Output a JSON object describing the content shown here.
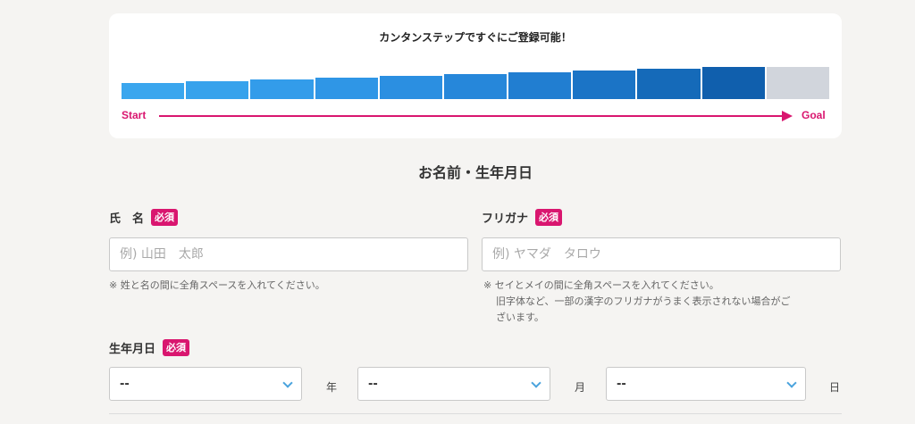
{
  "progress": {
    "title": "カンタンステップですぐにご登録可能！",
    "start_label": "Start",
    "goal_label": "Goal",
    "total_steps": 11,
    "completed_steps": 10,
    "step_colors": [
      "#3aa6ee",
      "#37a2ec",
      "#339cea",
      "#2f96e6",
      "#2b8fe1",
      "#2687da",
      "#217ed1",
      "#1b74c6",
      "#156ab9",
      "#105fad",
      "#d1d5dc"
    ],
    "accent_color": "#d9166f"
  },
  "section": {
    "title": "お名前・生年月日"
  },
  "name_field": {
    "label": "氏　名",
    "required_badge": "必須",
    "placeholder": "例) 山田　太郎",
    "note": "※ 姓と名の間に全角スペースを入れてください。"
  },
  "furigana_field": {
    "label": "フリガナ",
    "required_badge": "必須",
    "placeholder": "例) ヤマダ　タロウ",
    "note_line1": "※ セイとメイの間に全角スペースを入れてください。",
    "note_line2": "旧字体など、一部の漢字のフリガナがうまく表示されない場合がご",
    "note_line3": "ざいます。"
  },
  "birthdate_field": {
    "label": "生年月日",
    "required_badge": "必須",
    "year_value": "--",
    "year_unit": "年",
    "month_value": "--",
    "month_unit": "月",
    "day_value": "--",
    "day_unit": "日"
  }
}
